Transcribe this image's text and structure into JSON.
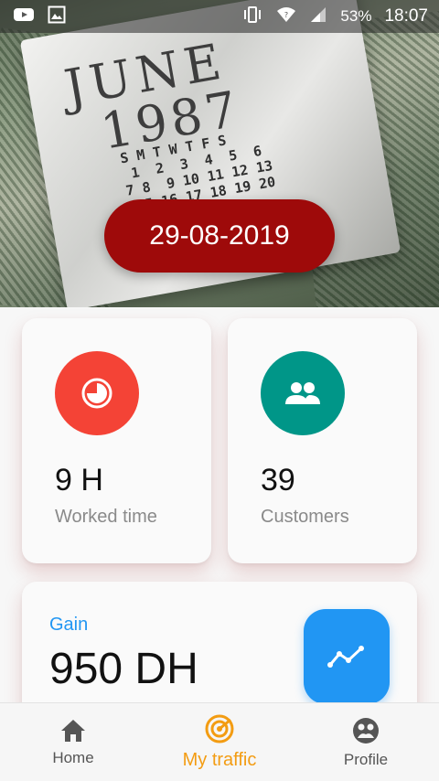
{
  "status_bar": {
    "battery": "53%",
    "time": "18:07",
    "icons": [
      "youtube-icon",
      "image-icon",
      "vibrate-icon",
      "wifi-icon",
      "signal-icon"
    ]
  },
  "hero": {
    "date": "29-08-2019",
    "image_text": {
      "month": "JUNE",
      "year": "1987"
    }
  },
  "cards": {
    "worked": {
      "value": "9 H",
      "label": "Worked time",
      "icon": "pie-clock-icon",
      "color": "#f44336"
    },
    "customers": {
      "value": "39",
      "label": "Customers",
      "icon": "people-icon",
      "color": "#009688"
    },
    "gain": {
      "label": "Gain",
      "value": "950 DH",
      "icon": "trending-icon",
      "color": "#2196f3"
    }
  },
  "nav": {
    "items": [
      {
        "label": "Home",
        "icon": "home-icon"
      },
      {
        "label": "My traffic",
        "icon": "traffic-icon",
        "active": true,
        "color": "#f39c12"
      },
      {
        "label": "Profile",
        "icon": "profile-icon"
      }
    ]
  }
}
